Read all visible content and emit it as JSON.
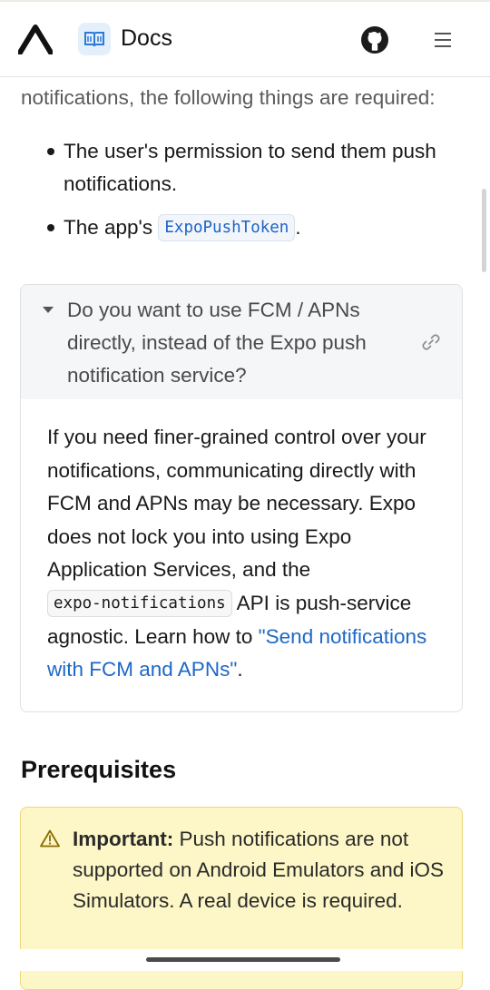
{
  "header": {
    "title": "Docs",
    "icons": [
      "expo-logo-icon",
      "book-icon",
      "github-icon",
      "hamburger-menu-icon"
    ]
  },
  "content": {
    "intro_text": "notifications, the following things are required:",
    "bullets": [
      {
        "text": "The user's permission to send them push notifications."
      },
      {
        "text_before": "The app's",
        "code": "ExpoPushToken",
        "text_after": "."
      }
    ],
    "details": {
      "summary": "Do you want to use FCM / APNs directly, instead of the Expo push notification service?",
      "body_part1": "If you need finer-grained control over your notifications, communicating directly with FCM and APNs may be necessary. Expo does not lock you into using Expo Application Services, and the",
      "body_code": "expo-notifications",
      "body_part2": "API is push-service agnostic. Learn how to",
      "body_link": "\"Send notifications with FCM and APNs\"",
      "body_end": "."
    },
    "prerequisites_heading": "Prerequisites",
    "callout": {
      "label": "Important:",
      "text": "Push notifications are not supported on Android Emulators and iOS Simulators. A real device is required."
    }
  },
  "colors": {
    "link": "#1e68c6",
    "callout_bg": "#fdf6c6",
    "callout_border": "#ecd77a",
    "docs_badge_bg": "#e3f0fc"
  }
}
